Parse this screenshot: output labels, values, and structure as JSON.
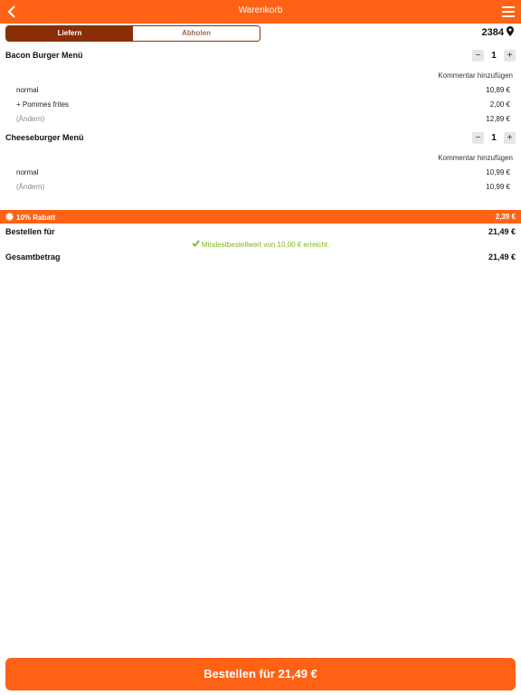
{
  "header": {
    "title": "Warenkorb",
    "back_icon": "chevron-left-icon",
    "menu_icon": "hamburger-menu-icon",
    "color": "#ff6215"
  },
  "delivery_toggle": {
    "options": [
      "Liefern",
      "Abholen"
    ],
    "selected": "Liefern"
  },
  "location": {
    "plz": "2384",
    "icon": "location-pin-icon"
  },
  "items": [
    {
      "name": "Bacon Burger Menü",
      "quantity": "1",
      "comment_label": "Kommentar hinzufügen",
      "lines": [
        {
          "label": "normal",
          "value": "10,89 €"
        },
        {
          "label": "+ Pommes frites",
          "value": "2,00 €"
        },
        {
          "label": "(Ändern)",
          "value": "12,89 €"
        }
      ]
    },
    {
      "name": "Cheeseburger Menü",
      "quantity": "1",
      "comment_label": "Kommentar hinzufügen",
      "lines": [
        {
          "label": "normal",
          "value": "10,99 €"
        },
        {
          "label": "(Ändern)",
          "value": "10,99 €"
        }
      ]
    }
  ],
  "discount": {
    "label": "10% Rabatt",
    "value": "2,39 €",
    "icon": "badge-icon"
  },
  "order_for": {
    "label": "Bestellen für",
    "value": "21,49 €"
  },
  "min_order_notice": "Mindestbestellwert von 10,00 € erreicht.",
  "total": {
    "label": "Gesamtbetrag",
    "value": "21,49 €"
  },
  "order_button": "Bestellen für 21,49 €"
}
